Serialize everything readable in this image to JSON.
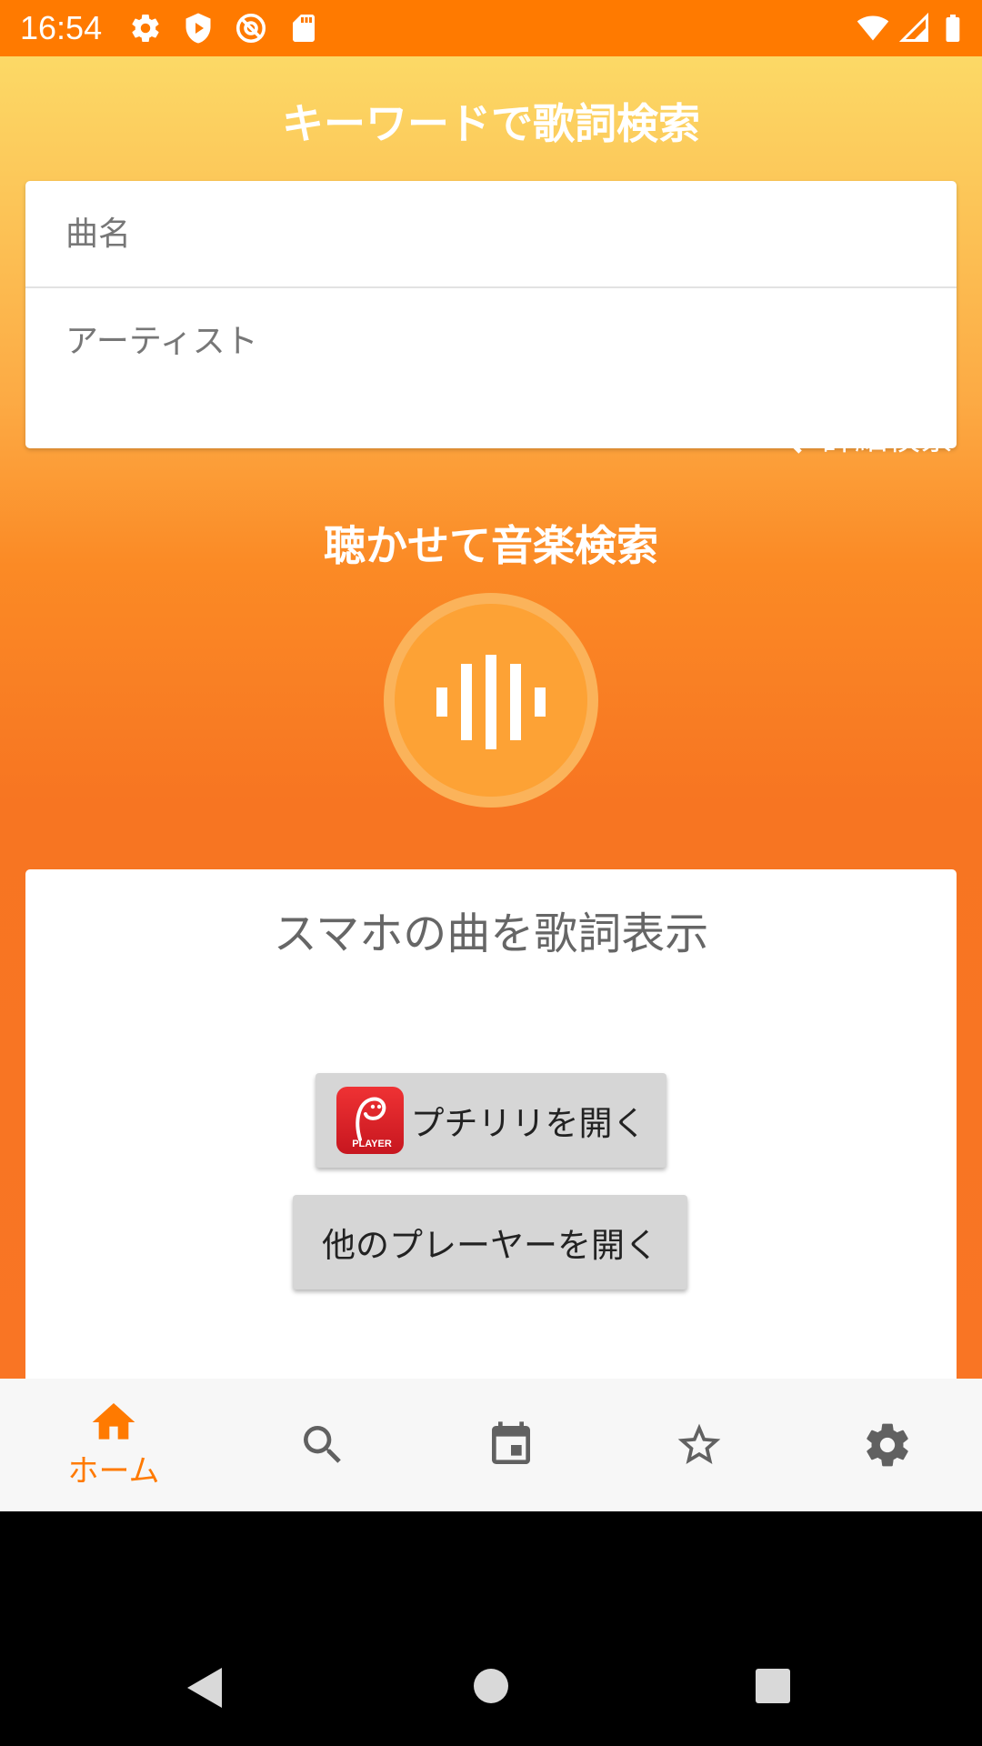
{
  "status_bar": {
    "time": "16:54",
    "left_icons": [
      "gear-icon",
      "shield-play-icon",
      "at-sign-icon",
      "sd-card-icon"
    ],
    "right_icons": [
      "wifi-icon",
      "signal-icon",
      "battery-icon"
    ]
  },
  "keyword_search": {
    "title": "キーワードで歌詞検索",
    "song_placeholder": "曲名",
    "artist_placeholder": "アーティスト",
    "detail_search_label": "詳細検索"
  },
  "listen_search": {
    "title": "聴かせて音楽検索",
    "icon": "sound-wave-icon"
  },
  "device_lyrics": {
    "title": "スマホの曲を歌詞表示",
    "open_puchiriri_label": "プチリリを開く",
    "puchiriri_logo_text": "PLAYER",
    "open_other_label": "他のプレーヤーを開く"
  },
  "bottom_nav": {
    "active": "home",
    "home_label": "ホーム",
    "items": [
      "home-icon",
      "search-icon",
      "calendar-icon",
      "star-icon",
      "settings-icon"
    ]
  },
  "colors": {
    "accent": "#ff7a00",
    "gradient_top": "#fcd966",
    "gradient_bottom": "#f77522",
    "button_gray": "#d6d6d6"
  }
}
